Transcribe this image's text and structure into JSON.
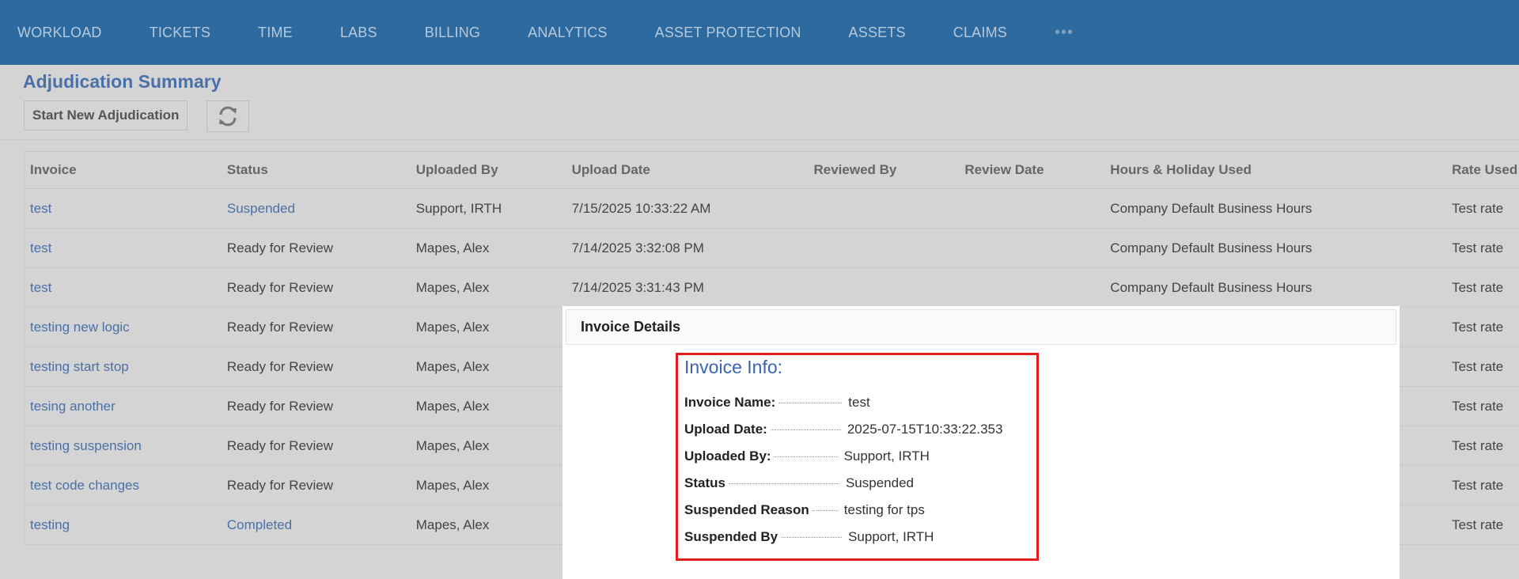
{
  "nav": {
    "items": [
      "WORKLOAD",
      "TICKETS",
      "TIME",
      "LABS",
      "BILLING",
      "ANALYTICS",
      "ASSET PROTECTION",
      "ASSETS",
      "CLAIMS"
    ],
    "more": "•••"
  },
  "page": {
    "title": "Adjudication Summary",
    "start_button": "Start New Adjudication"
  },
  "table": {
    "headers": [
      "Invoice",
      "Status",
      "Uploaded By",
      "Upload Date",
      "Reviewed By",
      "Review Date",
      "Hours & Holiday Used",
      "Rate Used"
    ],
    "rows": [
      {
        "invoice": "test",
        "status": "Suspended",
        "uploaded_by": "Support, IRTH",
        "upload_date": "7/15/2025 10:33:22 AM",
        "reviewed_by": "",
        "review_date": "",
        "hours": "Company Default Business Hours",
        "rate": "Test rate"
      },
      {
        "invoice": "test",
        "status": "Ready for Review",
        "uploaded_by": "Mapes, Alex",
        "upload_date": "7/14/2025 3:32:08 PM",
        "reviewed_by": "",
        "review_date": "",
        "hours": "Company Default Business Hours",
        "rate": "Test rate"
      },
      {
        "invoice": "test",
        "status": "Ready for Review",
        "uploaded_by": "Mapes, Alex",
        "upload_date": "7/14/2025 3:31:43 PM",
        "reviewed_by": "",
        "review_date": "",
        "hours": "Company Default Business Hours",
        "rate": "Test rate"
      },
      {
        "invoice": "testing new logic",
        "status": "Ready for Review",
        "uploaded_by": "Mapes, Alex",
        "upload_date": "",
        "reviewed_by": "",
        "review_date": "",
        "hours": "",
        "rate": "Test rate"
      },
      {
        "invoice": "testing start stop",
        "status": "Ready for Review",
        "uploaded_by": "Mapes, Alex",
        "upload_date": "",
        "reviewed_by": "",
        "review_date": "",
        "hours": "",
        "rate": "Test rate"
      },
      {
        "invoice": "tesing another",
        "status": "Ready for Review",
        "uploaded_by": "Mapes, Alex",
        "upload_date": "",
        "reviewed_by": "",
        "review_date": "",
        "hours": "",
        "rate": "Test rate"
      },
      {
        "invoice": "testing suspension",
        "status": "Ready for Review",
        "uploaded_by": "Mapes, Alex",
        "upload_date": "",
        "reviewed_by": "",
        "review_date": "",
        "hours": "",
        "rate": "Test rate"
      },
      {
        "invoice": "test code changes",
        "status": "Ready for Review",
        "uploaded_by": "Mapes, Alex",
        "upload_date": "",
        "reviewed_by": "",
        "review_date": "",
        "hours": "",
        "rate": "Test rate"
      },
      {
        "invoice": "testing",
        "status": "Completed",
        "uploaded_by": "Mapes, Alex",
        "upload_date": "",
        "reviewed_by": "",
        "review_date": "",
        "hours": "",
        "rate": "Test rate"
      }
    ]
  },
  "modal": {
    "title": "Invoice Details",
    "info_title": "Invoice Info:",
    "fields": [
      {
        "key": "Invoice Name:",
        "value": "test"
      },
      {
        "key": "Upload Date:",
        "value": "2025-07-15T10:33:22.353"
      },
      {
        "key": "Uploaded By:",
        "value": "Support, IRTH"
      },
      {
        "key": "Status",
        "value": "Suspended"
      },
      {
        "key": "Suspended Reason",
        "value": "testing for tps"
      },
      {
        "key": "Suspended By",
        "value": "Support, IRTH"
      }
    ]
  },
  "colors": {
    "nav_bg": "#2d6aa0",
    "link": "#4a70a8",
    "highlight_border": "#e11d1d"
  },
  "icons": {
    "refresh": "refresh-icon"
  }
}
